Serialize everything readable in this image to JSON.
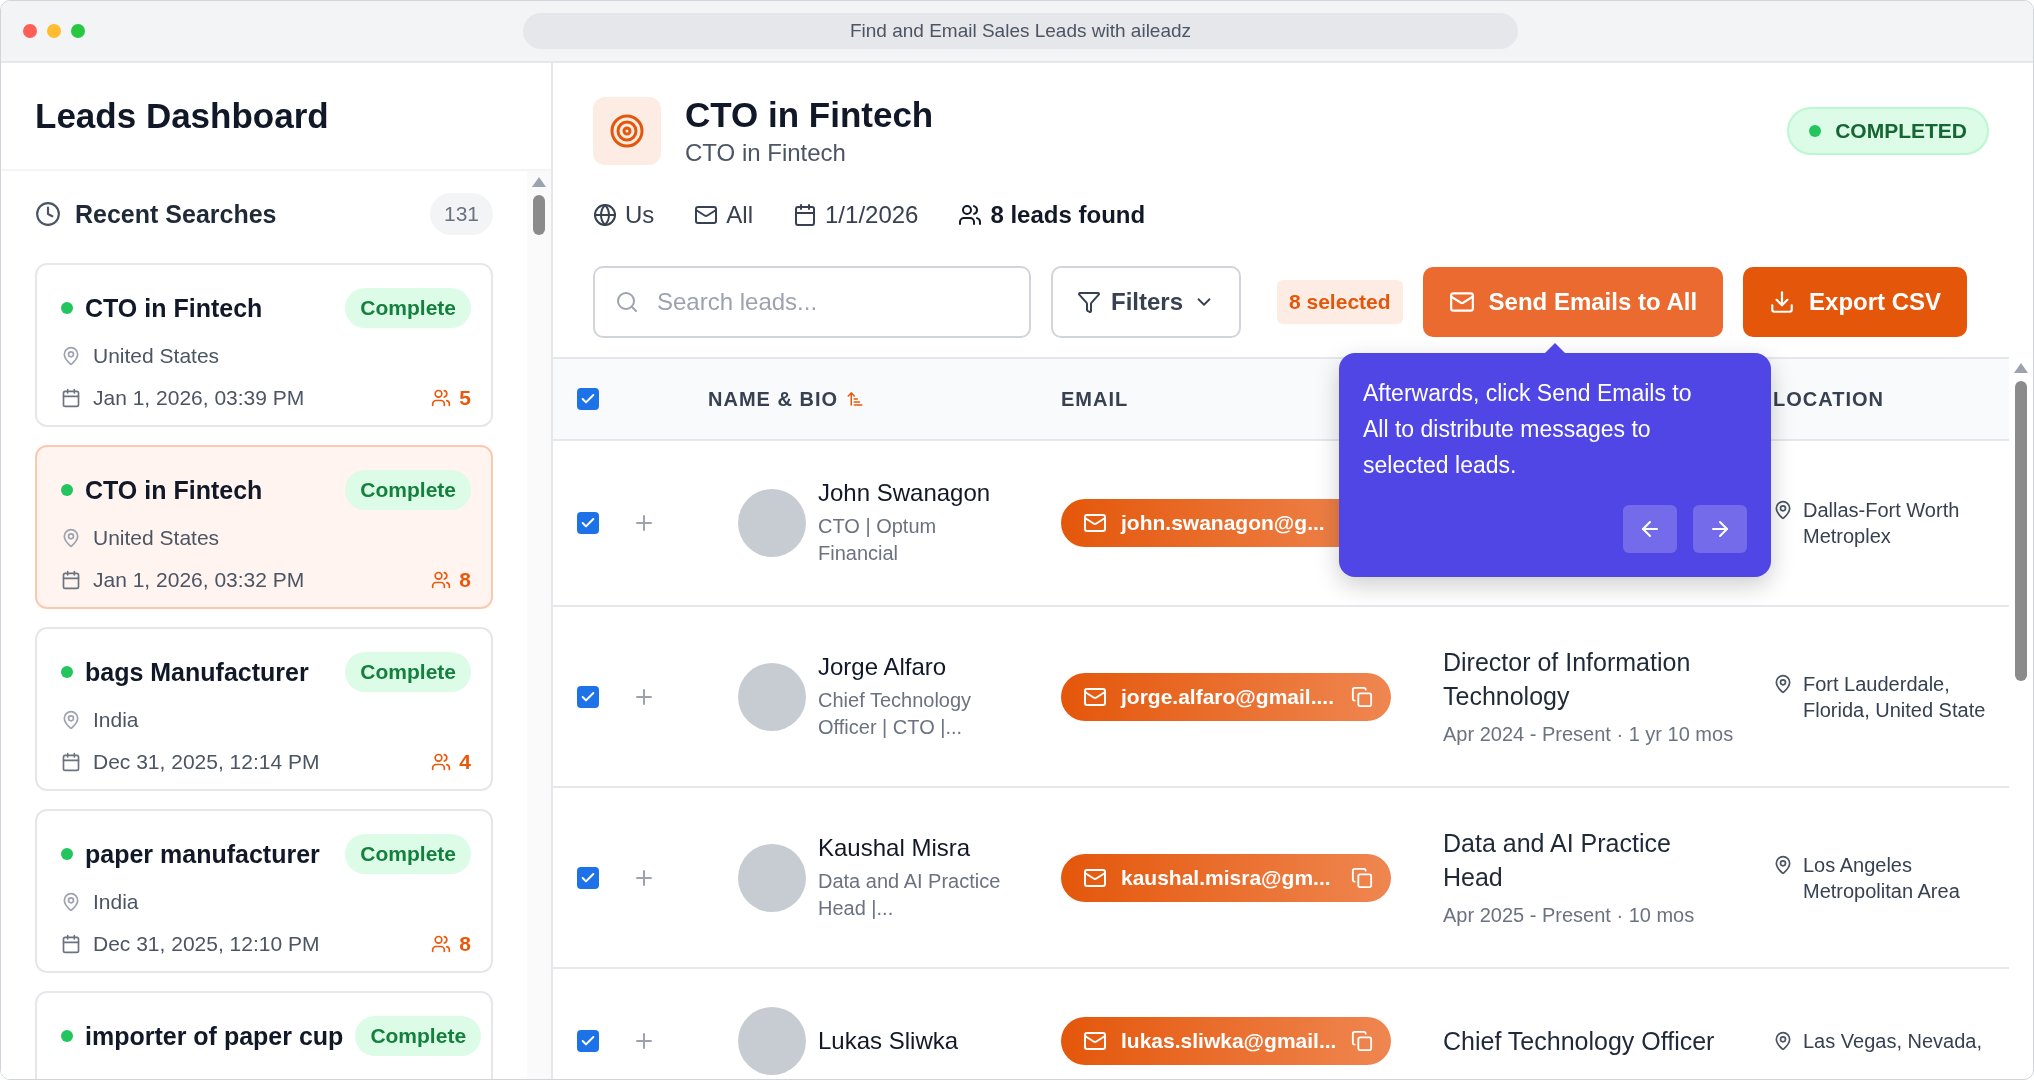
{
  "window": {
    "title": "Find and Email Sales Leads with aileadz"
  },
  "sidebar": {
    "title": "Leads Dashboard",
    "section": {
      "label": "Recent Searches",
      "count": "131"
    },
    "searches": [
      {
        "title": "CTO in Fintech",
        "status": "Complete",
        "location": "United States",
        "date": "Jan 1, 2026, 03:39 PM",
        "leads": "5",
        "selected": false
      },
      {
        "title": "CTO in Fintech",
        "status": "Complete",
        "location": "United States",
        "date": "Jan 1, 2026, 03:32 PM",
        "leads": "8",
        "selected": true
      },
      {
        "title": "bags Manufacturer",
        "status": "Complete",
        "location": "India",
        "date": "Dec 31, 2025, 12:14 PM",
        "leads": "4",
        "selected": false
      },
      {
        "title": "paper manufacturer",
        "status": "Complete",
        "location": "India",
        "date": "Dec 31, 2025, 12:10 PM",
        "leads": "8",
        "selected": false
      },
      {
        "title": "importer of paper cup",
        "status": "Complete",
        "selected": false
      }
    ]
  },
  "search_header": {
    "title": "CTO in Fintech",
    "subtitle": "CTO in Fintech",
    "status": "COMPLETED",
    "meta": [
      {
        "kind": "location",
        "text": "Us"
      },
      {
        "kind": "email",
        "text": "All"
      },
      {
        "kind": "date",
        "text": "1/1/2026"
      },
      {
        "kind": "leads",
        "text": "8 leads found"
      }
    ]
  },
  "toolbar": {
    "search": {
      "placeholder": "Search leads..."
    },
    "filters": "Filters",
    "selected_count": "8 selected",
    "send_button": "Send Emails to All",
    "export_button": "Export CSV"
  },
  "table": {
    "select_all": {
      "checked": true
    },
    "columns": [
      {
        "label": "NAME & BIO",
        "sorted": true
      },
      {
        "label": "EMAIL",
        "sorted": false
      },
      {
        "label": "LOCATION",
        "sorted": false
      }
    ],
    "rows": [
      {
        "checked": true,
        "name": "John Swanagon",
        "bio": "CTO | Optum Financial",
        "email": "john.swanagon@g...",
        "location": "Dallas-Fort Worth Metroplex"
      },
      {
        "checked": true,
        "name": "Jorge Alfaro",
        "bio": "Chief Technology Officer | CTO |...",
        "email": "jorge.alfaro@gmail....",
        "position": "Director of Information Technology",
        "tenure": "Apr 2024 - Present · 1 yr 10 mos",
        "location": "Fort Lauderdale, Florida, United State"
      },
      {
        "checked": true,
        "name": "Kaushal Misra",
        "bio": "Data and AI Practice Head |...",
        "email": "kaushal.misra@gm...",
        "position": "Data and AI Practice Head",
        "tenure": "Apr 2025 - Present · 10 mos",
        "location": "Los Angeles Metropolitan Area"
      },
      {
        "checked": true,
        "name": "Lukas Sliwka",
        "email": "lukas.sliwka@gmail...",
        "position": "Chief Technology Officer",
        "location": "Las Vegas, Nevada,"
      }
    ]
  },
  "tooltip": {
    "text": "Afterwards, click Send Emails to All to distribute messages to selected leads."
  }
}
